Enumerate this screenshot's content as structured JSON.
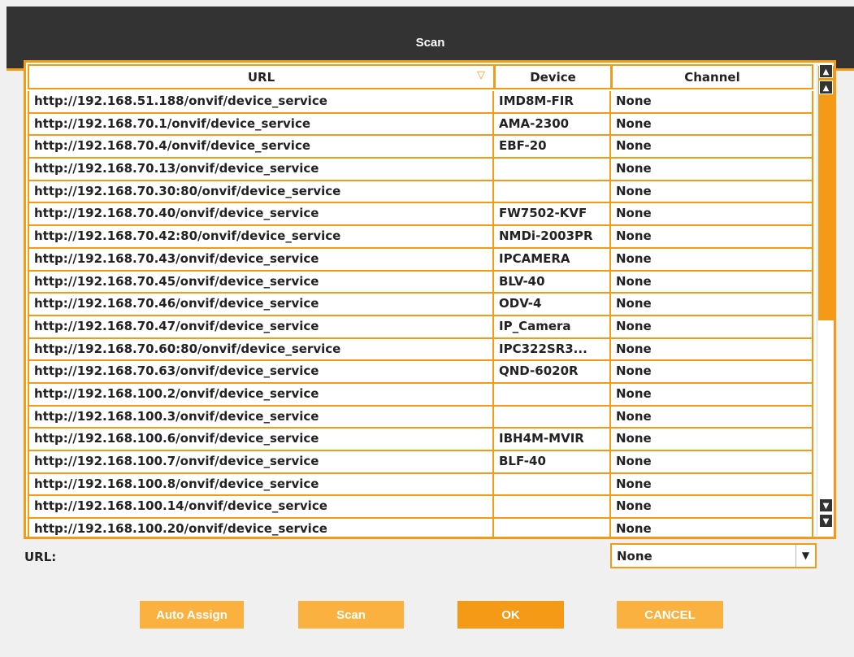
{
  "dialog": {
    "title": "Scan"
  },
  "table": {
    "columns": {
      "url": "URL",
      "device": "Device",
      "channel": "Channel"
    },
    "rows": [
      {
        "url": "http://192.168.51.188/onvif/device_service",
        "device": "IMD8M-FIR",
        "channel": "None"
      },
      {
        "url": "http://192.168.70.1/onvif/device_service",
        "device": "AMA-2300",
        "channel": "None"
      },
      {
        "url": "http://192.168.70.4/onvif/device_service",
        "device": "EBF-20",
        "channel": "None"
      },
      {
        "url": "http://192.168.70.13/onvif/device_service",
        "device": "",
        "channel": "None"
      },
      {
        "url": "http://192.168.70.30:80/onvif/device_service",
        "device": "",
        "channel": "None"
      },
      {
        "url": "http://192.168.70.40/onvif/device_service",
        "device": "FW7502-KVF",
        "channel": "None"
      },
      {
        "url": "http://192.168.70.42:80/onvif/device_service",
        "device": "NMDi-2003PR",
        "channel": "None"
      },
      {
        "url": "http://192.168.70.43/onvif/device_service",
        "device": "IPCAMERA",
        "channel": "None"
      },
      {
        "url": "http://192.168.70.45/onvif/device_service",
        "device": "BLV-40",
        "channel": "None"
      },
      {
        "url": "http://192.168.70.46/onvif/device_service",
        "device": "ODV-4",
        "channel": "None"
      },
      {
        "url": "http://192.168.70.47/onvif/device_service",
        "device": "IP_Camera",
        "channel": "None"
      },
      {
        "url": "http://192.168.70.60:80/onvif/device_service",
        "device": "IPC322SR3...",
        "channel": "None"
      },
      {
        "url": "http://192.168.70.63/onvif/device_service",
        "device": "QND-6020R",
        "channel": "None"
      },
      {
        "url": "http://192.168.100.2/onvif/device_service",
        "device": "",
        "channel": "None"
      },
      {
        "url": "http://192.168.100.3/onvif/device_service",
        "device": "",
        "channel": "None"
      },
      {
        "url": "http://192.168.100.6/onvif/device_service",
        "device": "IBH4M-MVIR",
        "channel": "None"
      },
      {
        "url": "http://192.168.100.7/onvif/device_service",
        "device": "BLF-40",
        "channel": "None"
      },
      {
        "url": "http://192.168.100.8/onvif/device_service",
        "device": "",
        "channel": "None"
      },
      {
        "url": "http://192.168.100.14/onvif/device_service",
        "device": "",
        "channel": "None"
      },
      {
        "url": "http://192.168.100.20/onvif/device_service",
        "device": "",
        "channel": "None"
      }
    ]
  },
  "url_field": {
    "label": "URL:",
    "selected": "None"
  },
  "buttons": {
    "auto_assign": "Auto Assign",
    "scan": "Scan",
    "ok": "OK",
    "cancel": "CANCEL"
  },
  "icons": {
    "sort": "sort-triangle-icon",
    "scroll_top": "scroll-top-icon",
    "scroll_up": "scroll-up-icon",
    "scroll_down": "scroll-down-icon",
    "scroll_bottom": "scroll-bottom-icon",
    "dropdown": "dropdown-arrow-icon"
  },
  "colors": {
    "accent": "#f59a16",
    "accent_light": "#fbb13f",
    "titlebar": "#333333"
  }
}
